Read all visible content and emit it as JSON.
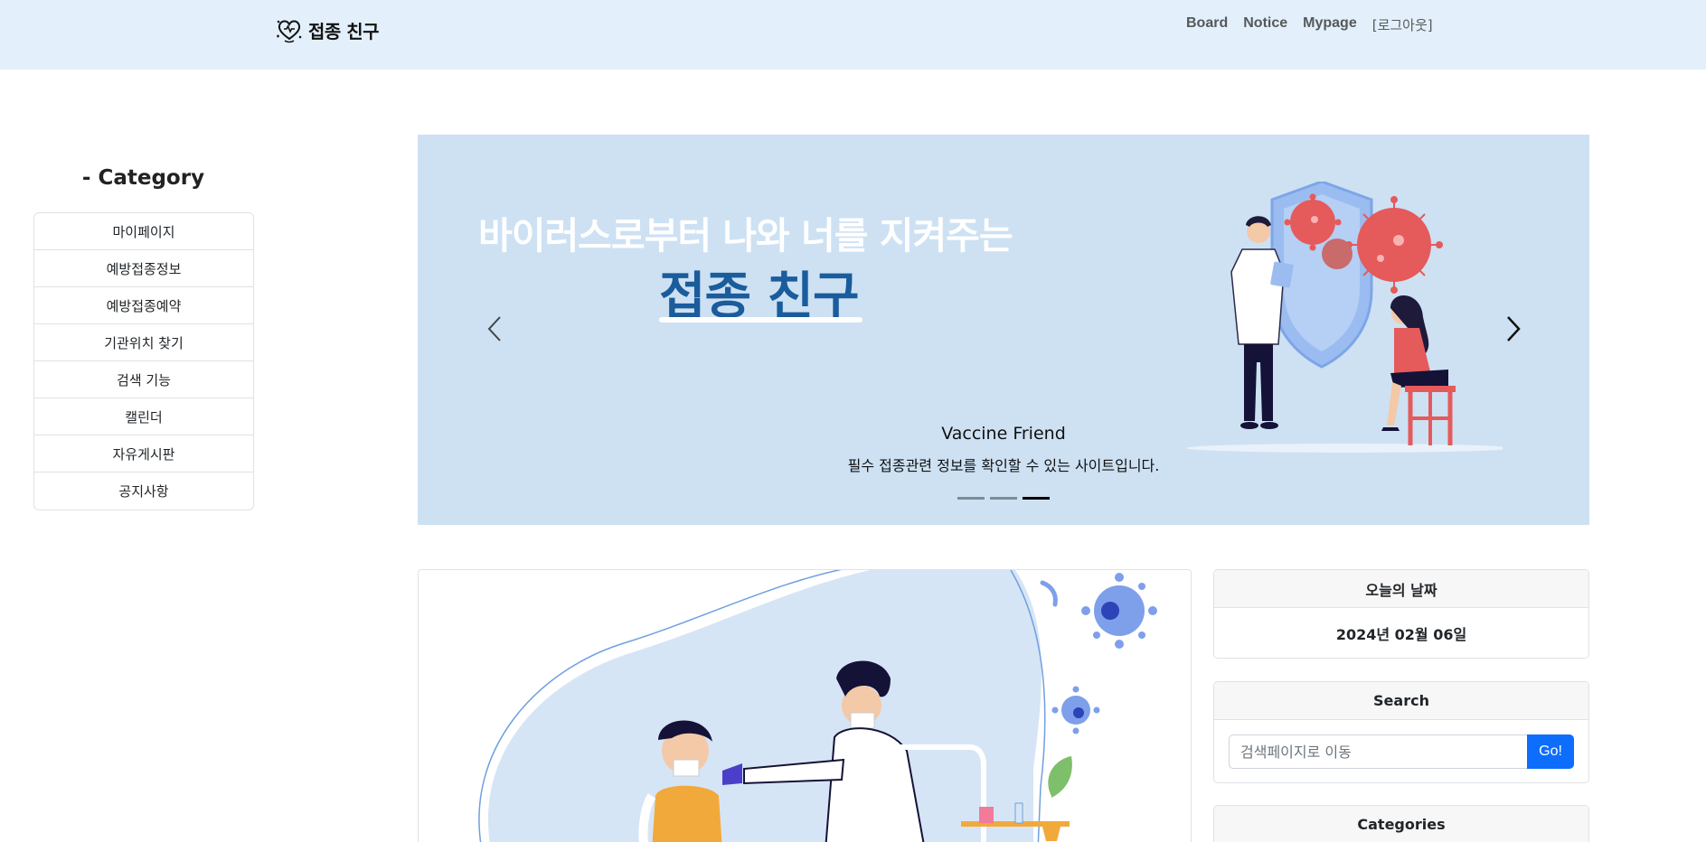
{
  "brand": {
    "name": "접종 친구",
    "logo_icon": "heart-logo-icon"
  },
  "nav": {
    "links": [
      "Board",
      "Notice",
      "Mypage",
      "[로그아웃]"
    ]
  },
  "sidebar": {
    "title": "- Category",
    "items": [
      "마이페이지",
      "예방접종정보",
      "예방접종예약",
      "기관위치 찾기",
      "검색 기능",
      "캘린더",
      "자유게시판",
      "공지사항"
    ]
  },
  "carousel": {
    "hero_line1": "바이러스로부터 나와 너를 지켜주는",
    "hero_line2": "접종 친구",
    "caption_title": "Vaccine Friend",
    "caption_sub": "필수 접종관련 정보를 확인할 수 있는 사이트입니다.",
    "slide_count": 3,
    "active_slide": 3,
    "prev_icon": "chevron-left-icon",
    "next_icon": "chevron-right-icon"
  },
  "widgets": {
    "date": {
      "title": "오늘의 날짜",
      "value": "2024년 02월 06일"
    },
    "search": {
      "title": "Search",
      "placeholder": "검색페이지로 이동",
      "button": "Go!"
    },
    "categories": {
      "title": "Categories"
    }
  },
  "colors": {
    "nav_bg": "#e3f0fb",
    "carousel_bg": "#cde1f3",
    "primary": "#0d6efd",
    "hero_blue": "#1a5c9c"
  }
}
